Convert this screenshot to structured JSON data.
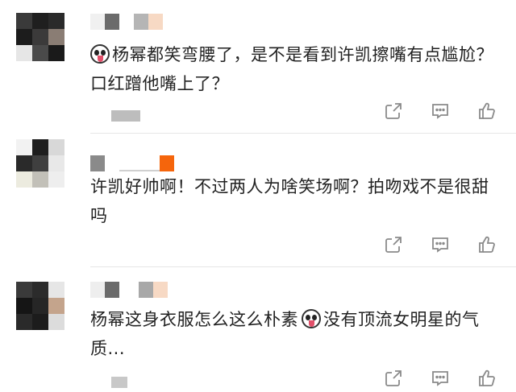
{
  "colors": {
    "text": "#222222",
    "icon": "#8a8a8a",
    "separator": "#e6e6e6",
    "accent_orange": "#f5650c"
  },
  "comments": [
    {
      "text_before_emoji": "",
      "text_after_emoji": "杨幂都笑弯腰了，是不是看到许凯擦嘴有点尴尬？口红蹭他嘴上了？",
      "has_emoji": true
    },
    {
      "text_before_emoji": "许凯好帅啊！不过两人为啥笑场啊？拍吻戏不是很甜吗",
      "text_after_emoji": "",
      "has_emoji": false
    },
    {
      "text_before_emoji": "杨幂这身衣服怎么这么朴素",
      "text_after_emoji": "没有顶流女明星的气质...",
      "has_emoji": true
    }
  ],
  "icons": {
    "share": "share-icon",
    "reply": "comment-icon",
    "like": "thumbs-up-icon"
  }
}
